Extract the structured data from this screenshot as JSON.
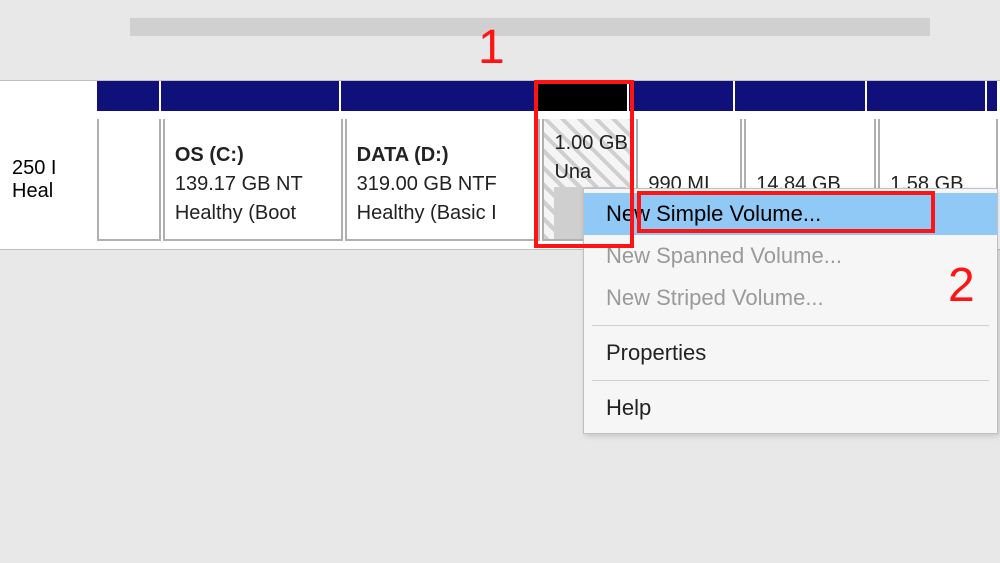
{
  "disk_strip": {
    "first_slot": {
      "line1": "250 I",
      "line2": "Heal"
    },
    "partitions": [
      {
        "title": "OS  (C:)",
        "size": "139.17 GB NT",
        "status": "Healthy (Boot"
      },
      {
        "title": "DATA  (D:)",
        "size": "319.00 GB NTF",
        "status": "Healthy (Basic I"
      },
      {
        "title": "",
        "size": "1.00 GB",
        "status": "Una"
      },
      {
        "title": "",
        "size": "990 MI",
        "status": ""
      },
      {
        "title": "",
        "size": "14.84 GB",
        "status": ""
      },
      {
        "title": "",
        "size": "1.58 GB",
        "status": ""
      }
    ]
  },
  "context_menu": {
    "items": [
      "New Simple Volume...",
      "New Spanned Volume...",
      "New Striped Volume..."
    ],
    "items2": [
      "Properties",
      "Help"
    ]
  },
  "annotations": {
    "label1": "1",
    "label2": "2"
  }
}
